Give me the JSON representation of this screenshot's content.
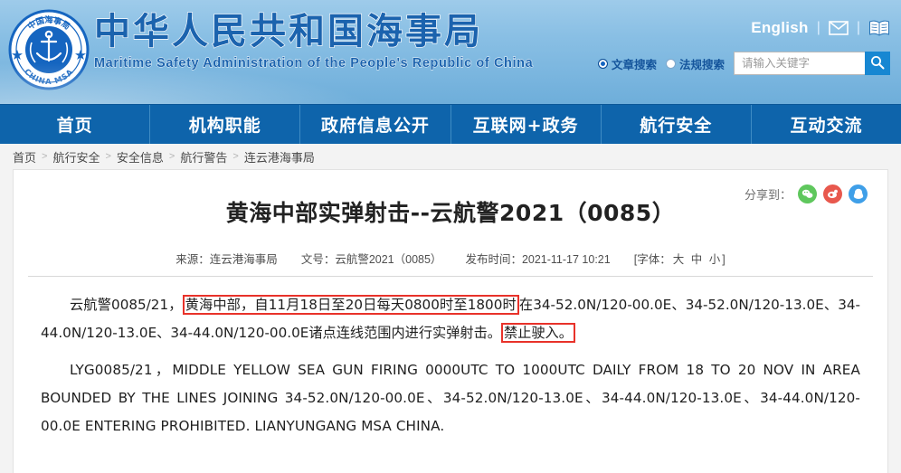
{
  "header": {
    "logo": {
      "icon": "china-msa-emblem",
      "ring_text_cn": "中国海事局",
      "ring_text_en": "CHINA MSA"
    },
    "title_cn": "中华人民共和国海事局",
    "title_en": "Maritime Safety Administration of the People's Republic of China",
    "english_link": "English",
    "mail_icon": "envelope-icon",
    "book_icon": "book-icon",
    "separator": "|",
    "search": {
      "radio_article": "文章搜索",
      "radio_regulation": "法规搜索",
      "selected": "文章搜索",
      "placeholder": "请输入关键字",
      "value": "",
      "button_icon": "search-icon"
    }
  },
  "nav": {
    "items": [
      {
        "label": "首页"
      },
      {
        "label": "机构职能"
      },
      {
        "label": "政府信息公开"
      },
      {
        "label": "互联网+政务"
      },
      {
        "label": "航行安全"
      },
      {
        "label": "互动交流"
      }
    ]
  },
  "breadcrumb": {
    "separator": ">",
    "items": [
      {
        "label": "首页"
      },
      {
        "label": "航行安全"
      },
      {
        "label": "安全信息"
      },
      {
        "label": "航行警告"
      },
      {
        "label": "连云港海事局"
      }
    ]
  },
  "article": {
    "share_label": "分享到：",
    "share_icons": [
      {
        "name": "wechat-share-icon",
        "color": "#5fc75d"
      },
      {
        "name": "weibo-share-icon",
        "color": "#e8584d"
      },
      {
        "name": "qq-share-icon",
        "color": "#3f9fe8"
      }
    ],
    "title": "黄海中部实弹射击--云航警2021（0085）",
    "meta": {
      "source": "来源：连云港海事局",
      "doc_number": "文号：云航警2021（0085）",
      "publish_time": "发布时间：2021-11-17 10:21",
      "font_label": "[字体：",
      "font_large": "大",
      "font_medium": "中",
      "font_small": "小",
      "font_close": "]"
    },
    "paragraph_cn": {
      "prefix": "云航警0085/21，",
      "highlight_1": "黄海中部，自11月18日至20日每天0800时至1800时",
      "middle": "在34-52.0N/120-00.0E、34-52.0N/120-13.0E、34-44.0N/120-13.0E、34-44.0N/120-00.0E诸点连线范围内进行实弹射击。",
      "highlight_2": "禁止驶入。"
    },
    "paragraph_en": "LYG0085/21，MIDDLE YELLOW SEA GUN FIRING 0000UTC TO 1000UTC DAILY FROM 18 TO 20 NOV IN AREA BOUNDED BY THE LINES JOINING 34-52.0N/120-00.0E、34-52.0N/120-13.0E、34-44.0N/120-13.0E、34-44.0N/120-00.0E ENTERING PROHIBITED. LIANYUNGANG MSA CHINA."
  },
  "colors": {
    "header_blue": "#89bfe4",
    "nav_blue": "#0e64ab",
    "brand_text": "#1b63ae",
    "highlight_red": "#e8322a",
    "search_btn": "#1787d2"
  }
}
